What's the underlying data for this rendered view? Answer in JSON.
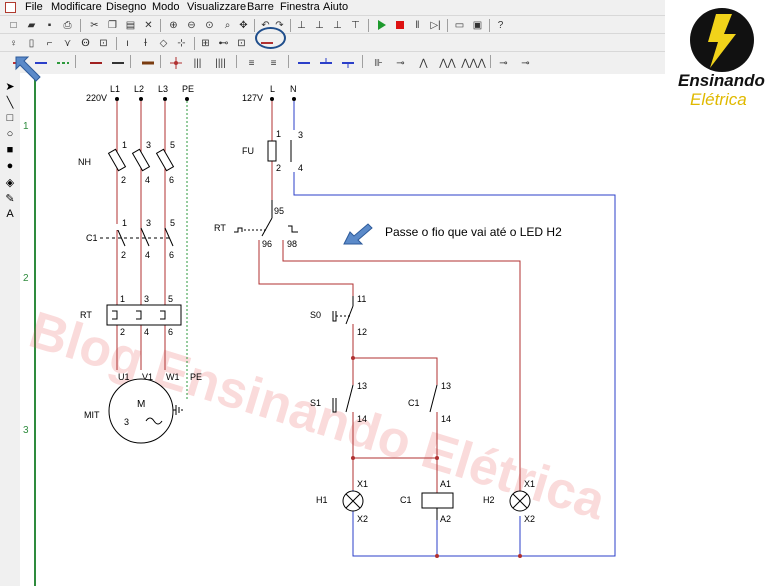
{
  "menu": [
    "File",
    "Modificare",
    "Disegno",
    "Modo",
    "Visualizzare",
    "Barre",
    "Finestra",
    "Aiuto"
  ],
  "ruler_rows": [
    "1",
    "2",
    "3"
  ],
  "power": {
    "voltage": "220V",
    "phases": [
      "L1",
      "L2",
      "L3",
      "PE"
    ],
    "nh_label": "NH",
    "c1_label": "C1",
    "rt_label": "RT",
    "motor_label": "MIT",
    "motor_symbol": "M",
    "motor_phase": "3",
    "terminals_top": [
      "1",
      "3",
      "5"
    ],
    "terminals_bottom": [
      "2",
      "4",
      "6"
    ],
    "motor_terminals": [
      "U1",
      "V1",
      "W1",
      "PE"
    ]
  },
  "control": {
    "voltage": "127V",
    "line_labels": [
      "L",
      "N"
    ],
    "fu_label": "FU",
    "fu_terminals": [
      "1",
      "2"
    ],
    "n_terminals": [
      "3",
      "4"
    ],
    "rt_label": "RT",
    "rt_terminals": [
      "95",
      "96",
      "98"
    ],
    "s0_label": "S0",
    "s0_terminals": [
      "11",
      "12"
    ],
    "s1_label": "S1",
    "s1_terminals": [
      "13",
      "14"
    ],
    "c1_aux_label": "C1",
    "c1_aux_terminals": [
      "13",
      "14"
    ],
    "h1_label": "H1",
    "h1_terminals": [
      "X1",
      "X2"
    ],
    "c1_coil_label": "C1",
    "c1_coil_terminals": [
      "A1",
      "A2"
    ],
    "h2_label": "H2",
    "h2_terminals": [
      "X1",
      "X2"
    ]
  },
  "annotation": "Passe o fio que vai até o LED H2",
  "watermark": "Blog Ensinando Elétrica",
  "logo": {
    "line1": "Ensinando",
    "line2": "Elétrica"
  },
  "colors": {
    "wire_red": "#b03030",
    "wire_blue": "#2b3fc9",
    "pe_green": "#2e9a3d",
    "accent_blue": "#1f4e8c",
    "logo_yellow": "#f1d31a"
  }
}
